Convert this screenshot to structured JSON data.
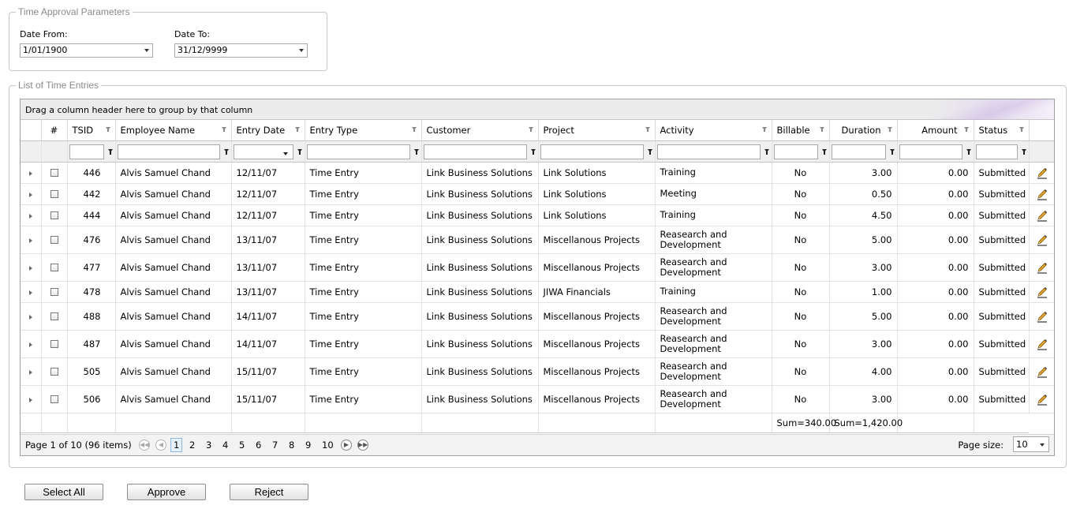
{
  "params": {
    "legend": "Time Approval Parameters",
    "date_from_label": "Date From:",
    "date_from_value": "1/01/1900",
    "date_to_label": "Date To:",
    "date_to_value": "31/12/9999"
  },
  "list": {
    "legend": "List of Time Entries",
    "group_hint": "Drag a column header here to group by that column"
  },
  "columns": [
    "#",
    "TSID",
    "Employee Name",
    "Entry Date",
    "Entry Type",
    "Customer",
    "Project",
    "Activity",
    "Billable",
    "Duration",
    "Amount",
    "Status"
  ],
  "rows": [
    {
      "tsid": "446",
      "employee": "Alvis Samuel Chand",
      "date": "12/11/07",
      "type": "Time Entry",
      "customer": "Link Business Solutions",
      "project": "Link Solutions",
      "activity": "Training",
      "billable": "No",
      "duration": "3.00",
      "amount": "0.00",
      "status": "Submitted"
    },
    {
      "tsid": "442",
      "employee": "Alvis Samuel Chand",
      "date": "12/11/07",
      "type": "Time Entry",
      "customer": "Link Business Solutions",
      "project": "Link Solutions",
      "activity": "Meeting",
      "billable": "No",
      "duration": "0.50",
      "amount": "0.00",
      "status": "Submitted"
    },
    {
      "tsid": "444",
      "employee": "Alvis Samuel Chand",
      "date": "12/11/07",
      "type": "Time Entry",
      "customer": "Link Business Solutions",
      "project": "Link Solutions",
      "activity": "Training",
      "billable": "No",
      "duration": "4.50",
      "amount": "0.00",
      "status": "Submitted"
    },
    {
      "tsid": "476",
      "employee": "Alvis Samuel Chand",
      "date": "13/11/07",
      "type": "Time Entry",
      "customer": "Link Business Solutions",
      "project": "Miscellanous Projects",
      "activity": "Reasearch and Development",
      "billable": "No",
      "duration": "5.00",
      "amount": "0.00",
      "status": "Submitted"
    },
    {
      "tsid": "477",
      "employee": "Alvis Samuel Chand",
      "date": "13/11/07",
      "type": "Time Entry",
      "customer": "Link Business Solutions",
      "project": "Miscellanous Projects",
      "activity": "Reasearch and Development",
      "billable": "No",
      "duration": "3.00",
      "amount": "0.00",
      "status": "Submitted"
    },
    {
      "tsid": "478",
      "employee": "Alvis Samuel Chand",
      "date": "13/11/07",
      "type": "Time Entry",
      "customer": "Link Business Solutions",
      "project": "JIWA Financials",
      "activity": "Training",
      "billable": "No",
      "duration": "1.00",
      "amount": "0.00",
      "status": "Submitted"
    },
    {
      "tsid": "488",
      "employee": "Alvis Samuel Chand",
      "date": "14/11/07",
      "type": "Time Entry",
      "customer": "Link Business Solutions",
      "project": "Miscellanous Projects",
      "activity": "Reasearch and Development",
      "billable": "No",
      "duration": "5.00",
      "amount": "0.00",
      "status": "Submitted"
    },
    {
      "tsid": "487",
      "employee": "Alvis Samuel Chand",
      "date": "14/11/07",
      "type": "Time Entry",
      "customer": "Link Business Solutions",
      "project": "Miscellanous Projects",
      "activity": "Reasearch and Development",
      "billable": "No",
      "duration": "3.00",
      "amount": "0.00",
      "status": "Submitted"
    },
    {
      "tsid": "505",
      "employee": "Alvis Samuel Chand",
      "date": "15/11/07",
      "type": "Time Entry",
      "customer": "Link Business Solutions",
      "project": "Miscellanous Projects",
      "activity": "Reasearch and Development",
      "billable": "No",
      "duration": "4.00",
      "amount": "0.00",
      "status": "Submitted"
    },
    {
      "tsid": "506",
      "employee": "Alvis Samuel Chand",
      "date": "15/11/07",
      "type": "Time Entry",
      "customer": "Link Business Solutions",
      "project": "Miscellanous Projects",
      "activity": "Reasearch and Development",
      "billable": "No",
      "duration": "3.00",
      "amount": "0.00",
      "status": "Submitted"
    }
  ],
  "footer": {
    "duration_sum": "Sum=340.00",
    "amount_sum": "Sum=1,420.00"
  },
  "pager": {
    "info": "Page 1 of 10 (96 items)",
    "pages": [
      "1",
      "2",
      "3",
      "4",
      "5",
      "6",
      "7",
      "8",
      "9",
      "10"
    ],
    "current_page": "1",
    "page_size_label": "Page size:",
    "page_size_value": "10"
  },
  "buttons": {
    "select_all": "Select All",
    "approve": "Approve",
    "reject": "Reject"
  },
  "icons": {
    "expand": "expand-arrow-icon",
    "filter": "filter-funnel-icon",
    "edit": "pencil-edit-icon",
    "dropdown": "chevron-down-icon"
  }
}
